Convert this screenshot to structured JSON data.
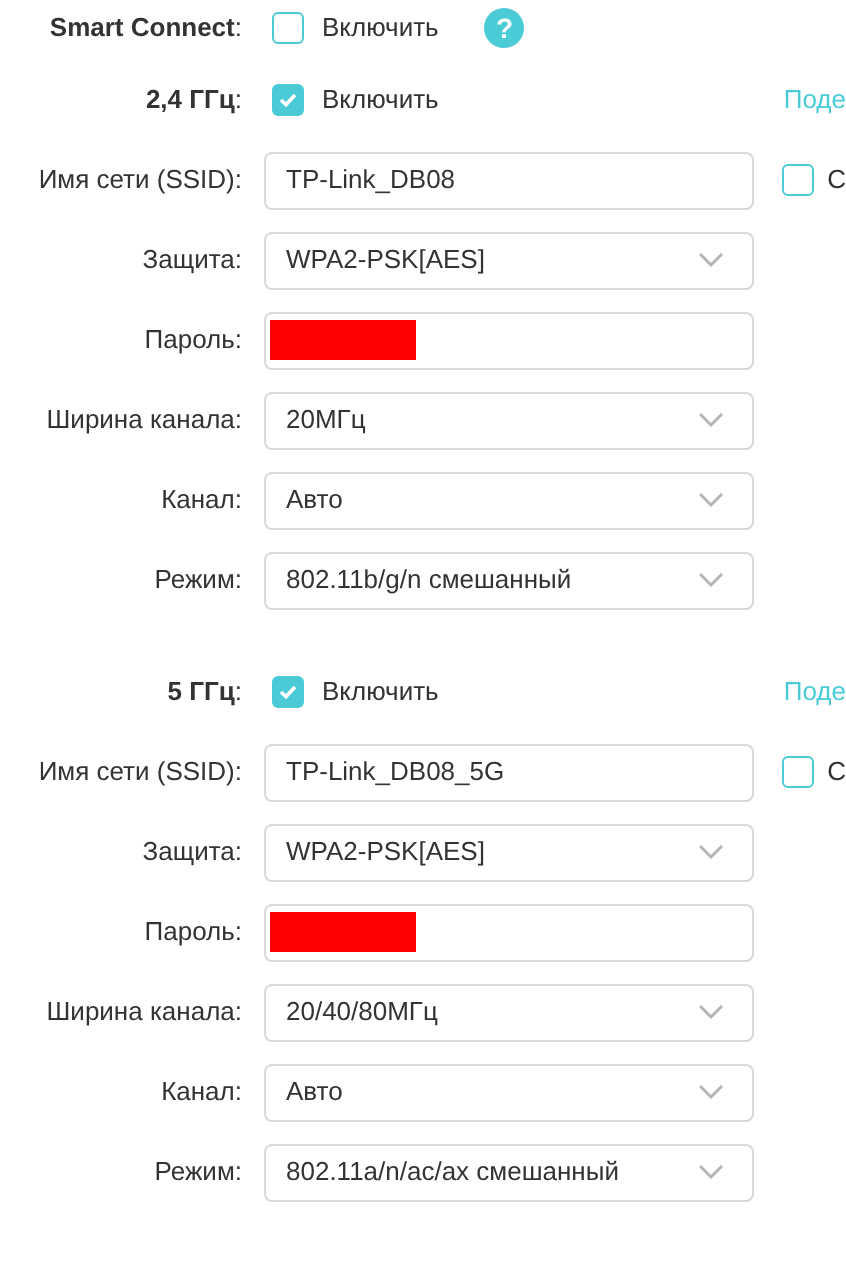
{
  "smart_connect": {
    "label": "**Smart Connect**:",
    "checkbox": {
      "label": "Включить",
      "checked": false
    },
    "help": "?"
  },
  "bands": [
    {
      "label": "**2,4 ГГц**:",
      "enable": {
        "label": "Включить",
        "checked": true
      },
      "link": "Поде",
      "fields": [
        {
          "kind": "text",
          "label": "Имя сети (SSID):",
          "value": "TP-Link_DB08",
          "side_checkbox": {
            "label": "С",
            "checked": false
          }
        },
        {
          "kind": "select",
          "label": "Защита:",
          "value": "WPA2-PSK[AES]"
        },
        {
          "kind": "password",
          "label": "Пароль:",
          "redacted": true
        },
        {
          "kind": "select",
          "label": "Ширина канала:",
          "value": "20МГц"
        },
        {
          "kind": "select",
          "label": "Канал:",
          "value": "Авто"
        },
        {
          "kind": "select",
          "label": "Режим:",
          "value": "802.11b/g/n смешанный"
        }
      ]
    },
    {
      "label": "**5 ГГц**:",
      "enable": {
        "label": "Включить",
        "checked": true
      },
      "link": "Поде",
      "fields": [
        {
          "kind": "text",
          "label": "Имя сети (SSID):",
          "value": "TP-Link_DB08_5G",
          "side_checkbox": {
            "label": "С",
            "checked": false
          }
        },
        {
          "kind": "select",
          "label": "Защита:",
          "value": "WPA2-PSK[AES]"
        },
        {
          "kind": "password",
          "label": "Пароль:",
          "redacted": true
        },
        {
          "kind": "select",
          "label": "Ширина канала:",
          "value": "20/40/80МГц"
        },
        {
          "kind": "select",
          "label": "Канал:",
          "value": "Авто"
        },
        {
          "kind": "select",
          "label": "Режим:",
          "value": "802.11a/n/ac/ax смешанный"
        }
      ]
    }
  ]
}
